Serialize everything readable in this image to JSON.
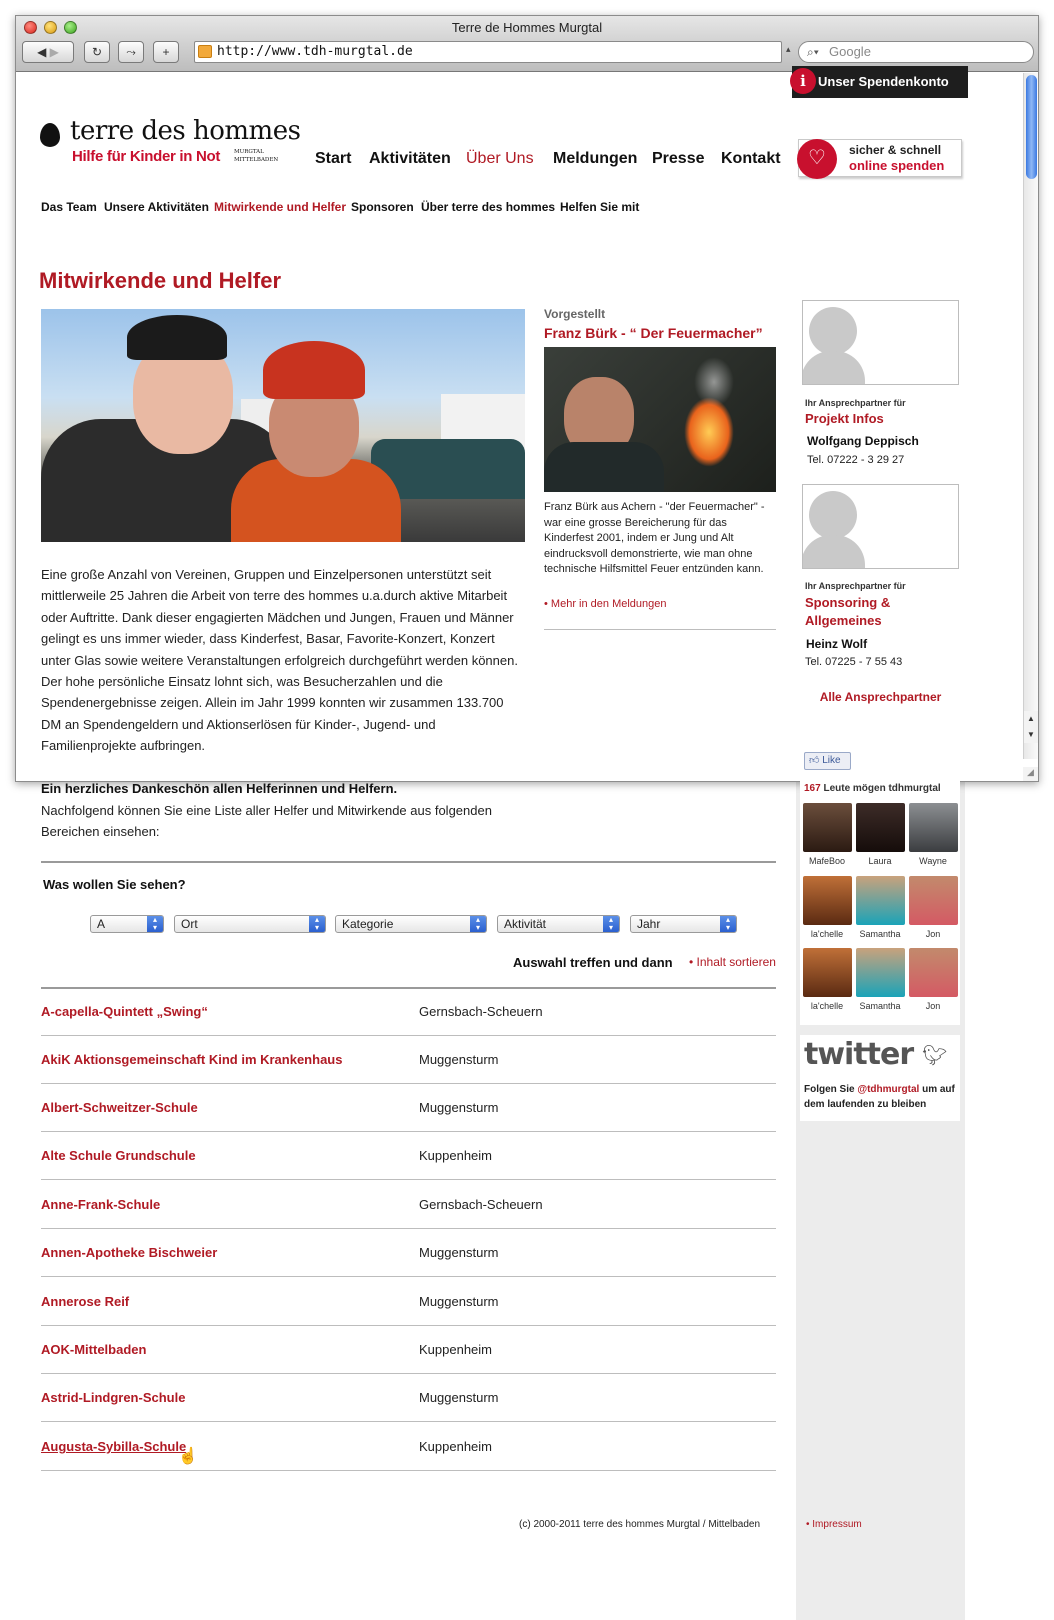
{
  "browser": {
    "title": "Terre de Hommes Murgtal",
    "url": "http://www.tdh-murgtal.de",
    "search_placeholder": "Google"
  },
  "spendenkonto": "Unser Spendenkonto",
  "logo": {
    "name": "terre des hommes",
    "tagline": "Hilfe für Kinder in Not",
    "region_line1": "MURGTAL",
    "region_line2": "MITTELBADEN"
  },
  "nav": {
    "items": [
      "Start",
      "Aktivitäten",
      "Über Uns",
      "Meldungen",
      "Presse",
      "Kontakt"
    ],
    "active": "Über Uns"
  },
  "subnav": {
    "items": [
      "Das Team",
      "Unsere Aktivitäten",
      "Mitwirkende und Helfer",
      "Sponsoren",
      "Über terre des hommes",
      "Helfen Sie mit"
    ],
    "active": "Mitwirkende und Helfer"
  },
  "spenden": {
    "line1": "sicher & schnell",
    "line2": "online spenden"
  },
  "page_title": "Mitwirkende und Helfer",
  "intro_text": "Eine große Anzahl von Vereinen, Gruppen und Einzelpersonen unterstützt seit mittlerweile 25 Jahren die Arbeit von terre des hommes u.a.durch aktive Mitarbeit oder Auftritte. Dank dieser engagierten Mädchen und Jungen, Frauen und Männer gelingt es uns immer wieder, dass Kinderfest, Basar, Favorite-Konzert, Konzert unter Glas sowie weitere Veranstaltungen erfolgreich durchgeführt werden können. Der hohe persönliche Einsatz lohnt sich, was Besucherzahlen und die Spendenergebnisse zeigen. Allein im Jahr 1999 konnten wir zusammen 133.700 DM an Spendengeldern und Aktionserlösen für Kinder-, Jugend- und Familienprojekte aufbringen.",
  "feature": {
    "kicker": "Vorgestellt",
    "title": "Franz Bürk - “ Der Feuermacher”",
    "text": "Franz Bürk aus Achern - \"der Feuermacher\" - war eine grosse Bereicherung für das Kinderfest 2001, indem er Jung und Alt eindrucksvoll demonstrierte, wie man ohne technische Hilfsmittel Feuer entzünden kann.",
    "more": "Mehr in den Meldungen"
  },
  "thanks": {
    "bold": "Ein herzliches Dankeschön allen Helferinnen und Helfern.",
    "text": "Nachfolgend können Sie eine Liste aller Helfer und Mitwirkende aus folgenden Bereichen einsehen:"
  },
  "filter": {
    "question": "Was wollen Sie sehen?",
    "selects": [
      "A",
      "Ort",
      "Kategorie",
      "Aktivität",
      "Jahr"
    ],
    "action_text": "Auswahl treffen und dann",
    "action_link": "Inhalt sortieren"
  },
  "helpers": [
    {
      "name": "A-capella-Quintett „Swing“",
      "ort": "Gernsbach-Scheuern"
    },
    {
      "name": "AkiK Aktionsgemeinschaft Kind im Krankenhaus",
      "ort": "Muggensturm"
    },
    {
      "name": "Albert-Schweitzer-Schule",
      "ort": "Muggensturm"
    },
    {
      "name": "Alte Schule Grundschule",
      "ort": "Kuppenheim"
    },
    {
      "name": "Anne-Frank-Schule",
      "ort": "Gernsbach-Scheuern"
    },
    {
      "name": "Annen-Apotheke Bischweier",
      "ort": "Muggensturm"
    },
    {
      "name": "Annerose Reif",
      "ort": "Muggensturm"
    },
    {
      "name": "AOK-Mittelbaden",
      "ort": "Kuppenheim"
    },
    {
      "name": "Astrid-Lindgren-Schule",
      "ort": "Muggensturm"
    },
    {
      "name": "Augusta-Sybilla-Schule",
      "ort": "Kuppenheim"
    }
  ],
  "contacts": [
    {
      "label": "Ihr Ansprechpartner für",
      "topic": "Projekt Infos",
      "person": "Wolfgang Deppisch",
      "phone": "Tel. 07222 - 3 29 27"
    },
    {
      "label": "Ihr Ansprechpartner für",
      "topic": "Sponsoring & Allgemeines",
      "person": "Heinz Wolf",
      "phone": "Tel. 07225 - 7 55 43"
    }
  ],
  "all_contacts": "Alle Ansprechpartner",
  "facebook": {
    "like": "Like",
    "count": "167",
    "likes_text": "Leute mögen tdhmurgtal",
    "fans": [
      "MafeBoo",
      "Laura",
      "Wayne",
      "la'chelle",
      "Samantha",
      "Jon",
      "la'chelle",
      "Samantha",
      "Jon"
    ]
  },
  "twitter": {
    "logo": "twitter",
    "pre": "Folgen Sie",
    "handle": "@tdhmurgtal",
    "post": "um auf dem laufenden zu bleiben"
  },
  "footer": {
    "copyright": "(c) 2000-2011 terre des hommes Murgtal / Mittelbaden",
    "impressum": "Impressum"
  },
  "colors": {
    "brand_red": "#b01a24",
    "sidebar_bg": "#ececec"
  }
}
